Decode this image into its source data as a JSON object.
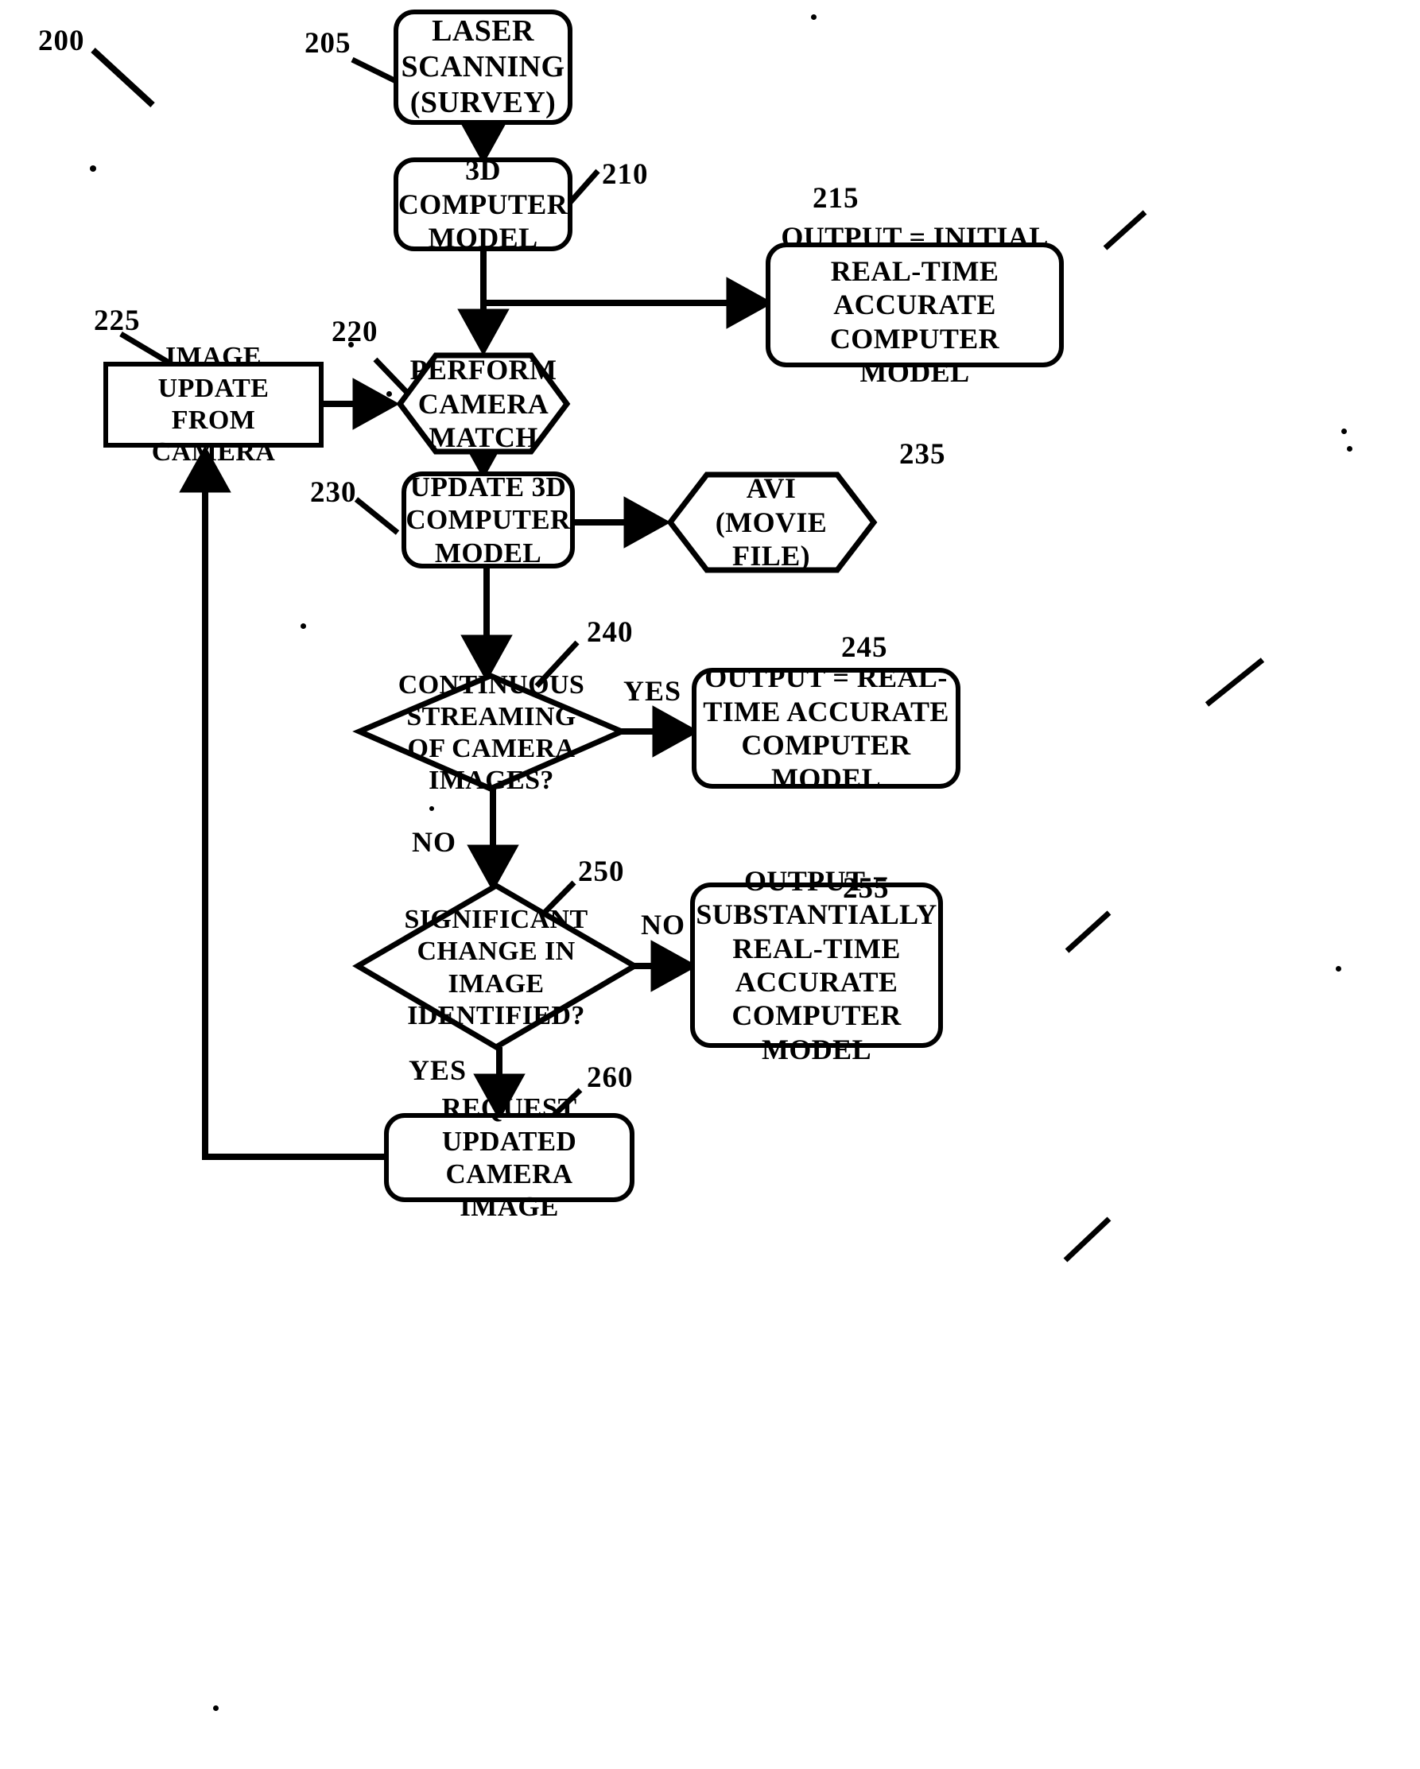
{
  "figure": {
    "ref_label": "200",
    "type": "flowchart",
    "title": ""
  },
  "nodes": [
    {
      "id": "205",
      "ref": "205",
      "shape": "rounded-rectangle",
      "text": "LASER\nSCANNING\n(SURVEY)",
      "name": "node-laser-scanning"
    },
    {
      "id": "210",
      "ref": "210",
      "shape": "rounded-rectangle",
      "text": "3D\nCOMPUTER\nMODEL",
      "name": "node-3d-computer-model"
    },
    {
      "id": "215",
      "ref": "215",
      "shape": "rounded-rectangle",
      "text": "OUTPUT = INITIAL\nREAL-TIME\nACCURATE\nCOMPUTER MODEL",
      "name": "node-output-initial-model"
    },
    {
      "id": "220",
      "ref": "220",
      "shape": "hexagon",
      "text": "PERFORM\nCAMERA\nMATCH",
      "name": "node-perform-camera-match"
    },
    {
      "id": "225",
      "ref": "225",
      "shape": "rectangle",
      "text": "IMAGE UPDATE\nFROM CAMERA",
      "name": "node-image-update-from-camera"
    },
    {
      "id": "230",
      "ref": "230",
      "shape": "rounded-rectangle",
      "text": "UPDATE 3D\nCOMPUTER\nMODEL",
      "name": "node-update-3d-computer-model"
    },
    {
      "id": "235",
      "ref": "235",
      "shape": "hexagon",
      "text": "AVI\n(MOVIE\nFILE)",
      "name": "node-avi-movie-file"
    },
    {
      "id": "240",
      "ref": "240",
      "shape": "diamond",
      "text": "CONTINUOUS\nSTREAMING\nOF CAMERA\nIMAGES?",
      "name": "node-continuous-streaming-decision"
    },
    {
      "id": "245",
      "ref": "245",
      "shape": "rounded-rectangle",
      "text": "OUTPUT = REAL-\nTIME ACCURATE\nCOMPUTER MODEL",
      "name": "node-output-realtime-model"
    },
    {
      "id": "250",
      "ref": "250",
      "shape": "diamond",
      "text": "SIGNIFICANT\nCHANGE IN IMAGE\nIDENTIFIED?",
      "name": "node-significant-change-decision"
    },
    {
      "id": "255",
      "ref": "255",
      "shape": "rounded-rectangle",
      "text": "OUTPUT =\nSUBSTANTIALLY\nREAL-TIME\nACCURATE\nCOMPUTER MODEL",
      "name": "node-output-substantially-realtime-model"
    },
    {
      "id": "260",
      "ref": "260",
      "shape": "rounded-rectangle",
      "text": "REQUEST UPDATED\nCAMERA IMAGE",
      "name": "node-request-updated-camera-image"
    }
  ],
  "edge_labels": {
    "streaming_yes": "YES",
    "streaming_no": "NO",
    "change_no": "NO",
    "change_yes": "YES"
  },
  "colors": {
    "ink": "#000000",
    "paper": "#ffffff"
  }
}
